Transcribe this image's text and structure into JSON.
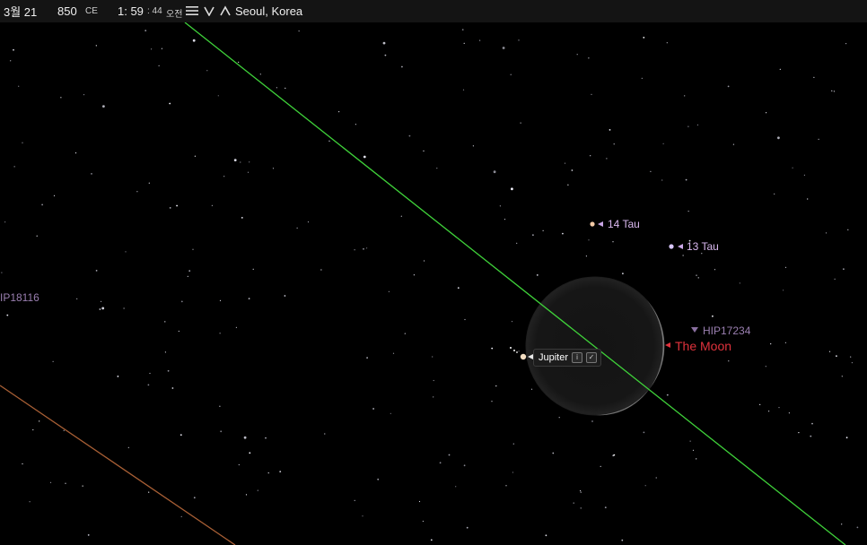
{
  "toolbar": {
    "date": "3월 21",
    "year": "850",
    "era": "CE",
    "time_hm": "1: 59",
    "time_s": ": 44",
    "ampm": "오전",
    "location": "Seoul, Korea"
  },
  "labels": {
    "tau14": "14 Tau",
    "tau13": "13 Tau",
    "hip18116": "IP18116",
    "hip17234": "HIP17234",
    "moon": "The Moon",
    "jupiter": "Jupiter"
  },
  "colors": {
    "star_label": "#d9b8ef",
    "dim_label": "#9a7fb0",
    "moon_label": "#e0323c",
    "ecliptic": "#3fd23a",
    "horizon": "#a85f35"
  }
}
